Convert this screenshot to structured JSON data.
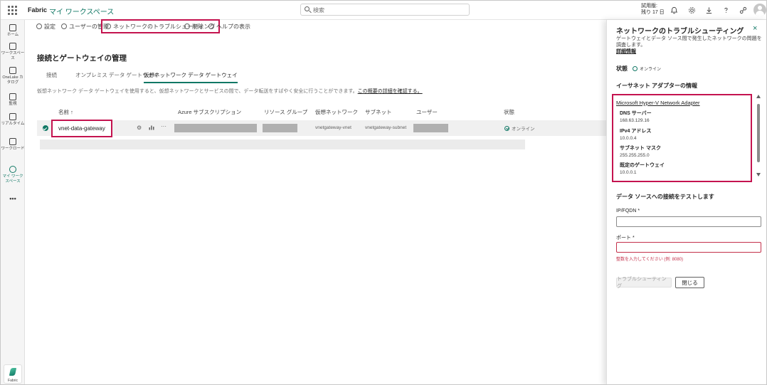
{
  "topbar": {
    "brand": "Fabric",
    "workspace": "マイ ワークスペース",
    "search_placeholder": "検索",
    "trial_line1": "試用版:",
    "trial_line2": "残り 17 日"
  },
  "leftnav": {
    "items": [
      {
        "label": "ホーム"
      },
      {
        "label": "ワークスペース"
      },
      {
        "label": "OneLake カタログ"
      },
      {
        "label": "監視"
      },
      {
        "label": "リアルタイム"
      },
      {
        "label": "ワークロード"
      },
      {
        "label": "マイ ワークスペース"
      }
    ],
    "more": "•••",
    "logo_label": "Fabric"
  },
  "cmdbar": {
    "settings": "設定",
    "manage_users": "ユーザーの管理",
    "troubleshoot": "ネットワークのトラブルシューティング",
    "delete": "削除",
    "help": "ヘルプの表示"
  },
  "page": {
    "title": "接続とゲートウェイの管理",
    "tabs": [
      {
        "label": "接続"
      },
      {
        "label": "オンプレミス データ ゲートウェイ"
      },
      {
        "label": "仮想ネットワーク データ ゲートウェイ"
      }
    ],
    "desc": "仮想ネットワーク データ ゲートウェイを使用すると、仮想ネットワークとサービスの間で、データ転送をすばやく安全に行うことができます。",
    "desc_link": "この概要の詳細を確認する。"
  },
  "table": {
    "headers": {
      "name": "名前 ↑",
      "subscription": "Azure サブスクリプション",
      "resource_group": "リソース グループ",
      "vnet": "仮想ネットワーク",
      "subnet": "サブネット",
      "user": "ユーザー",
      "status": "状態"
    },
    "row": {
      "name": "vnet-data-gateway",
      "vnet": "vnetgateway-vnet",
      "subnet": "vnetgateway-subnet",
      "status": "オンライン",
      "more": "···"
    }
  },
  "panel": {
    "title": "ネットワークのトラブルシューティング",
    "close": "×",
    "desc": "ゲートウェイとデータ ソース間で発生したネットワークの問題を調査します。",
    "desc_link": "詳細情報",
    "status_label": "状態",
    "status_value": "オンライン",
    "ethernet_label": "イーサネット アダプターの情報",
    "adapter": {
      "name": "Microsoft Hyper-V Network Adapter",
      "items": [
        {
          "key": "DNS サーバー",
          "value": "168.63.129.16"
        },
        {
          "key": "IPv4 アドレス",
          "value": "10.0.0.4"
        },
        {
          "key": "サブネット マスク",
          "value": "255.255.255.0"
        },
        {
          "key": "既定のゲートウェイ",
          "value": "10.0.0.1"
        }
      ]
    },
    "test_label": "データ ソースへの接続をテストします",
    "ip_label": "IP/FQDN *",
    "port_label": "ポート *",
    "port_error": "整数を入力してください (例: 8080)",
    "btn_troubleshoot": "トラブルシューティング",
    "btn_close": "閉じる"
  },
  "colors": {
    "accent": "#117865",
    "highlight": "#c4134f",
    "error": "#c4314b"
  }
}
